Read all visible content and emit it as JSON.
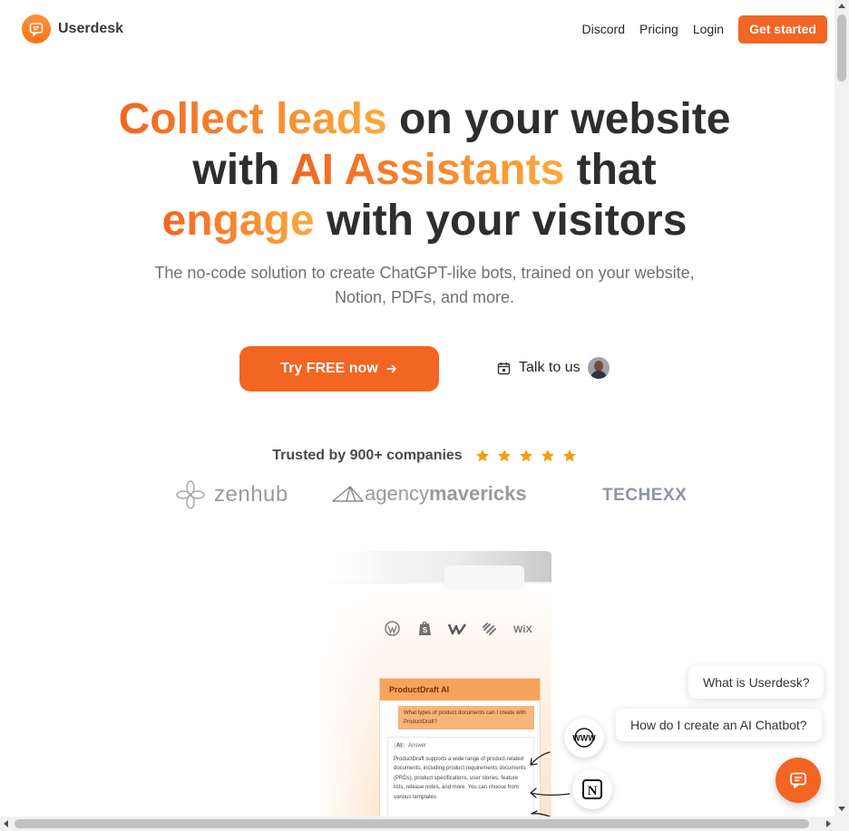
{
  "brand": {
    "name": "Userdesk",
    "accent": "#f26522",
    "icon": "chat-bubble-icon"
  },
  "nav": {
    "links": [
      "Discord",
      "Pricing",
      "Login"
    ],
    "cta": "Get started"
  },
  "hero": {
    "line1": {
      "accent": "Collect leads",
      "rest": " on your website"
    },
    "line2": {
      "start": "with ",
      "accent": "AI Assistants",
      "end": " that"
    },
    "line3": {
      "accent": "engage",
      "rest": " with your visitors"
    },
    "subtitle": "The no-code solution to create ChatGPT-like bots, trained on your website, Notion, PDFs, and more."
  },
  "actions": {
    "try": "Try FREE now",
    "talk": "Talk to us",
    "talk_icon": "calendar-icon",
    "try_icon": "arrow-right-icon"
  },
  "trust": {
    "text": "Trusted by 900+ companies",
    "stars": 5,
    "star_color": "#f59e0b"
  },
  "logos": {
    "zenhub": "zenhub",
    "agency_light": "agency",
    "agency_bold": "mavericks",
    "techexx": "TECHEXX"
  },
  "illustration": {
    "platforms": [
      "wordpress-icon",
      "shopify-icon",
      "webflow-icon",
      "squarespace-icon",
      "WiX"
    ],
    "chat_title": "ProductDraft AI",
    "question": "What types of product documents can I create with ProductDraft?",
    "answer_tag": "AI",
    "answer_label": "Answer",
    "answer": "ProductDraft supports a wide range of product-related documents, including product requirements documents (PRDs), product specifications, user stories, feature lists, release notes, and more. You can choose from various templates",
    "sources": [
      "WWW",
      "N"
    ]
  },
  "widget": {
    "bubbles": [
      "What is Userdesk?",
      "How do I create an AI Chatbot?"
    ],
    "launcher_icon": "chat-bubble-icon"
  }
}
